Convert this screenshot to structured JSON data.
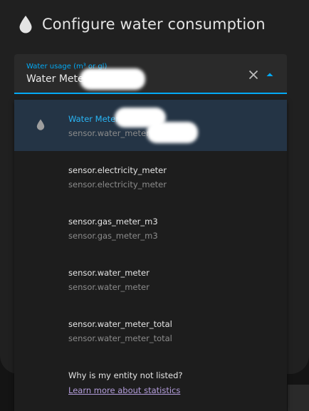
{
  "dialog": {
    "title": "Configure water consumption",
    "title_icon": "water-drop-icon"
  },
  "field": {
    "label": "Water usage (m³ or gl)",
    "value": "Water Meter",
    "clear_icon": "close-icon",
    "toggle_icon": "arrow-up-icon"
  },
  "options": [
    {
      "primary": "Water Meter",
      "secondary": "sensor.water_meter",
      "icon": "water-drop-icon",
      "selected": true
    },
    {
      "primary": "sensor.electricity_meter",
      "secondary": "sensor.electricity_meter"
    },
    {
      "primary": "sensor.gas_meter_m3",
      "secondary": "sensor.gas_meter_m3"
    },
    {
      "primary": "sensor.water_meter",
      "secondary": "sensor.water_meter"
    },
    {
      "primary": "sensor.water_meter_total",
      "secondary": "sensor.water_meter_total"
    }
  ],
  "footer": {
    "question": "Why is my entity not listed?",
    "link": "Learn more about statistics"
  },
  "colors": {
    "accent": "#03a9f4",
    "selected_bg": "#243445",
    "link": "#b39ddb",
    "dialog_bg": "#202020"
  }
}
